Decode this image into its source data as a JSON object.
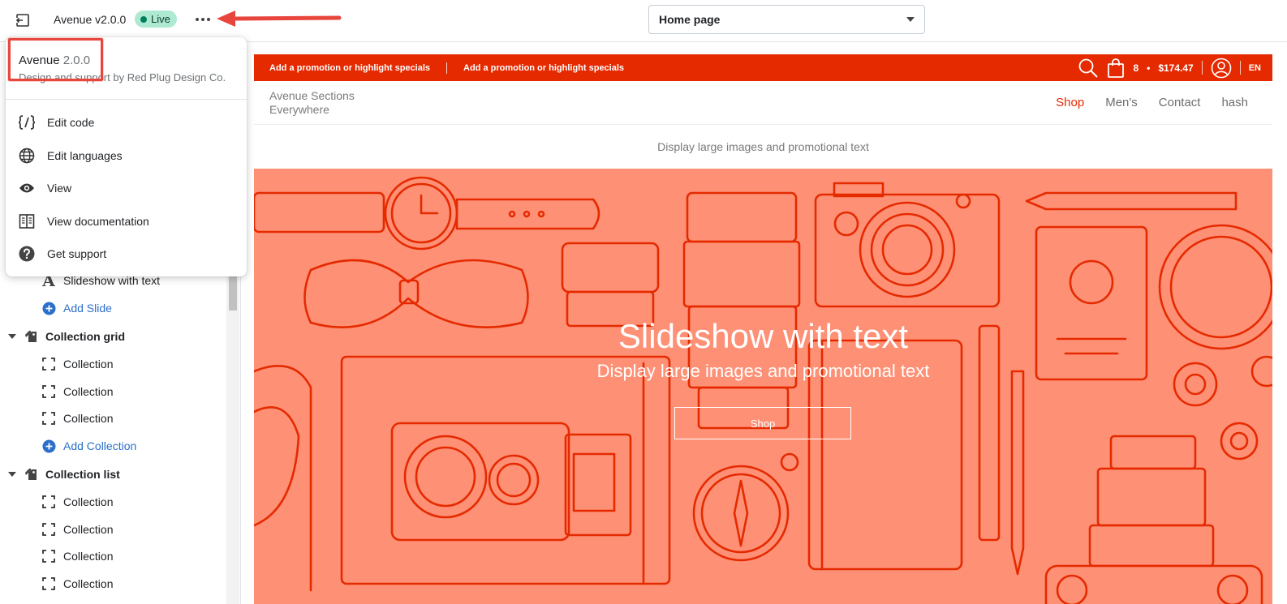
{
  "topbar": {
    "exit_icon": "exit-icon",
    "theme_name": "Avenue v2.0.0",
    "live_label": "Live",
    "more_icon": "more-horizontal-icon",
    "page_selector": "Home page"
  },
  "popover": {
    "title_name": "Avenue",
    "title_version": "2.0.0",
    "subtitle": "Design and support by Red Plug Design Co.",
    "items": [
      {
        "label": "Edit code",
        "icon": "code-icon"
      },
      {
        "label": "Edit languages",
        "icon": "globe-icon"
      },
      {
        "label": "View",
        "icon": "eye-icon"
      },
      {
        "label": "View documentation",
        "icon": "book-icon"
      },
      {
        "label": "Get support",
        "icon": "question-icon"
      }
    ]
  },
  "sidebar": {
    "rows": [
      {
        "label": "Slideshow with text",
        "kind": "child",
        "icon": "text-letter-icon"
      },
      {
        "label": "Add Slide",
        "kind": "add",
        "icon": "add-circle-icon"
      },
      {
        "label": "Collection grid",
        "kind": "group",
        "icon": "collection-tag-icon"
      },
      {
        "label": "Collection",
        "kind": "child",
        "icon": "collection-block-icon"
      },
      {
        "label": "Collection",
        "kind": "child",
        "icon": "collection-block-icon"
      },
      {
        "label": "Collection",
        "kind": "child",
        "icon": "collection-block-icon"
      },
      {
        "label": "Add Collection",
        "kind": "add",
        "icon": "add-circle-icon"
      },
      {
        "label": "Collection list",
        "kind": "group",
        "icon": "collection-tag-icon"
      },
      {
        "label": "Collection",
        "kind": "child",
        "icon": "collection-block-icon"
      },
      {
        "label": "Collection",
        "kind": "child",
        "icon": "collection-block-icon"
      },
      {
        "label": "Collection",
        "kind": "child",
        "icon": "collection-block-icon"
      },
      {
        "label": "Collection",
        "kind": "child",
        "icon": "collection-block-icon"
      }
    ]
  },
  "preview": {
    "promo_1": "Add a promotion or highlight specials",
    "promo_2": "Add a promotion or highlight specials",
    "cart_count": "8",
    "cart_dot": "•",
    "cart_total": "$174.47",
    "language": "EN",
    "store_name": "Avenue Sections Everywhere",
    "nav": [
      "Shop",
      "Men's",
      "Contact",
      "hash"
    ],
    "tagline": "Display large images and promotional text",
    "hero_title": "Slideshow with text",
    "hero_subtitle": "Display large images and promotional text",
    "hero_button": "Shop"
  },
  "colors": {
    "accent_red": "#e52a00",
    "hero_bg": "#fe9076",
    "live_badge_bg": "#aee9d1",
    "link_blue": "#2c6ecb",
    "annotation_red": "#e8453c"
  }
}
